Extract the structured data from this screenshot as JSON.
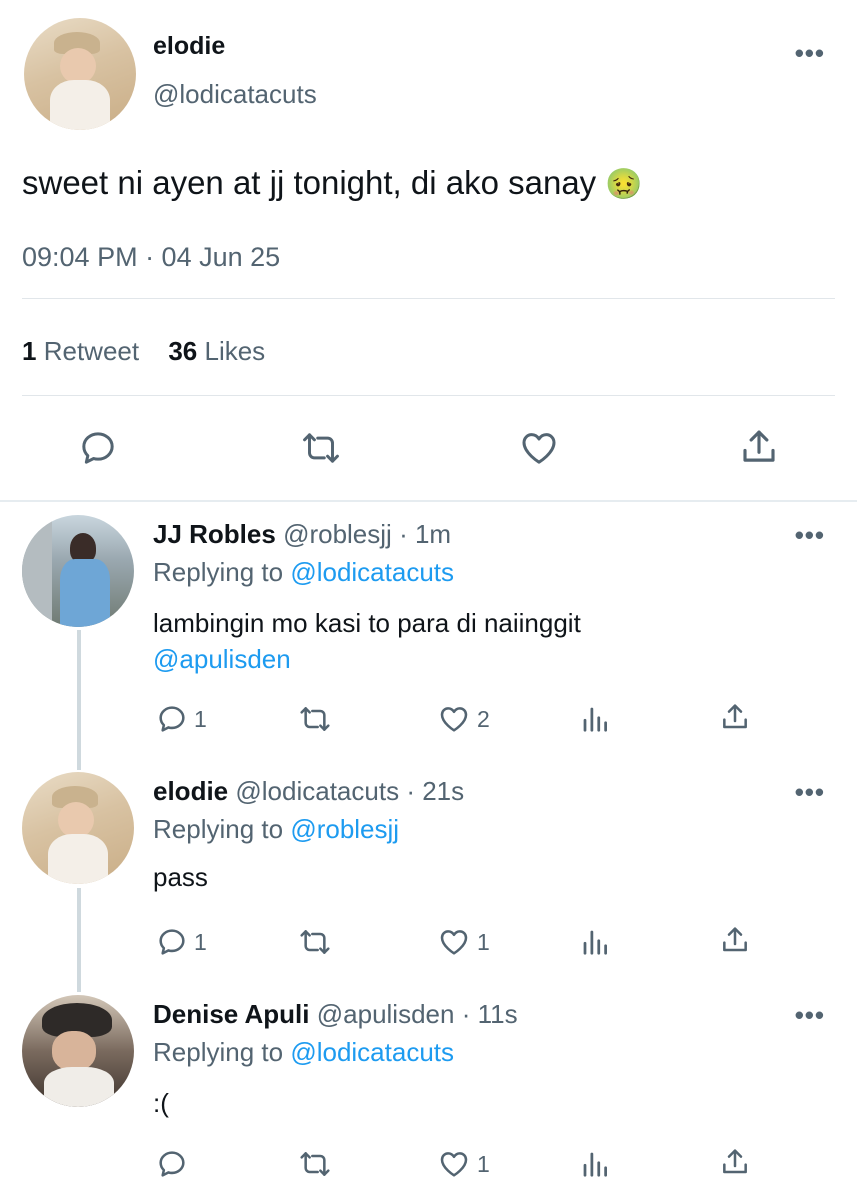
{
  "main_tweet": {
    "display_name": "elodie",
    "handle": "@lodicatacuts",
    "text": "sweet ni ayen at jj tonight, di ako sanay",
    "emoji": "🤢",
    "timestamp": "09:04 PM · 04 Jun 25",
    "retweets_count": "1",
    "retweets_label": "Retweet",
    "likes_count": "36",
    "likes_label": "Likes",
    "more_label": "•••"
  },
  "replies": [
    {
      "display_name": "JJ Robles",
      "handle": "@roblesjj",
      "time": "· 1m",
      "replying_label": "Replying to",
      "replying_to": "@lodicatacuts",
      "text": "lambingin mo kasi to para di naiinggit",
      "mention": "@apulisden",
      "reply_count": "1",
      "retweet_count": "",
      "like_count": "2",
      "more_label": "•••"
    },
    {
      "display_name": "elodie",
      "handle": "@lodicatacuts",
      "time": "· 21s",
      "replying_label": "Replying to",
      "replying_to": "@roblesjj",
      "text": "pass",
      "reply_count": "1",
      "retweet_count": "",
      "like_count": "1",
      "more_label": "•••"
    },
    {
      "display_name": "Denise Apuli",
      "handle": "@apulisden",
      "time": "· 11s",
      "replying_label": "Replying to",
      "replying_to": "@lodicatacuts",
      "text": ":(",
      "reply_count": "",
      "retweet_count": "",
      "like_count": "1",
      "more_label": "•••"
    }
  ],
  "colors": {
    "text": "#0f1419",
    "secondary": "#536471",
    "link": "#1d9bf0",
    "divider": "#e1e6ea"
  }
}
